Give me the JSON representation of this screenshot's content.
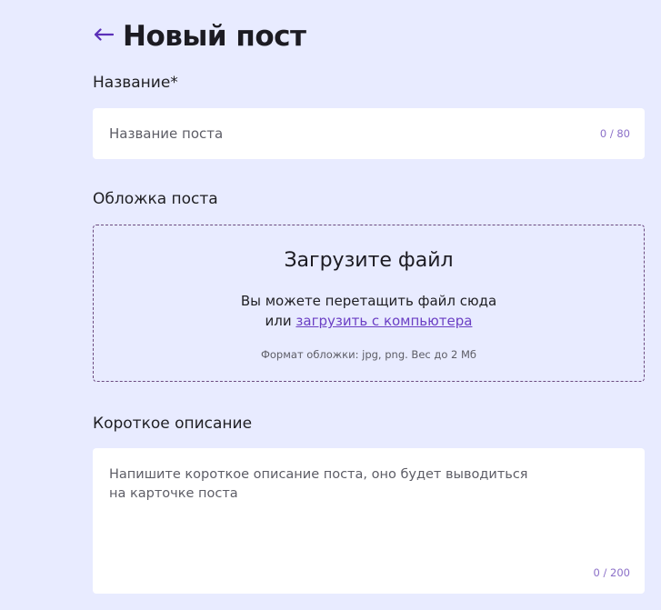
{
  "header": {
    "title": "Новый пост"
  },
  "title_field": {
    "label": "Название*",
    "placeholder": "Название поста",
    "value": "",
    "counter": "0 / 80"
  },
  "cover": {
    "label": "Обложка поста",
    "heading": "Загрузите файл",
    "drag_text": "Вы можете перетащить файл сюда",
    "or_text": "или",
    "upload_link": "загрузить с компьютера",
    "format_hint": "Формат обложки: jpg, png. Вес до 2 Мб"
  },
  "description_field": {
    "label": "Короткое описание",
    "placeholder": "Напишите короткое описание поста, оно будет выводиться\nна карточке поста",
    "value": "",
    "counter": "0 / 200"
  },
  "colors": {
    "background": "#e8ebff",
    "accent": "#6b3fc4",
    "counter": "#8b6fc8",
    "back_arrow": "#5b2fb8"
  }
}
